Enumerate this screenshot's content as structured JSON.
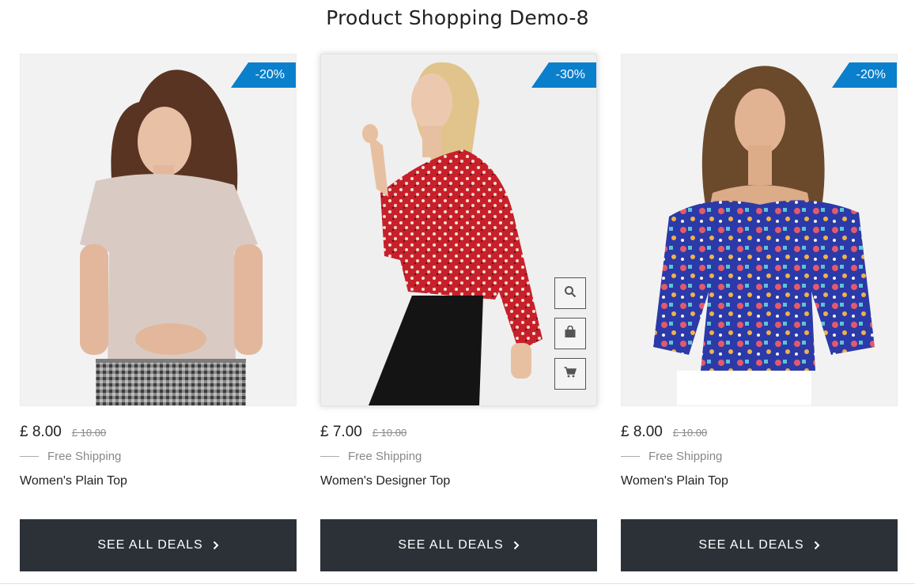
{
  "page": {
    "title": "Product Shopping Demo-8"
  },
  "products": [
    {
      "discount": "-20%",
      "price": "£ 8.00",
      "old_price": "£ 10.00",
      "shipping": "Free Shipping",
      "name": "Women's Plain Top",
      "cta": "SEE ALL DEALS"
    },
    {
      "discount": "-30%",
      "price": "£ 7.00",
      "old_price": "£ 10.00",
      "shipping": "Free Shipping",
      "name": "Women's Designer Top",
      "cta": "SEE ALL DEALS"
    },
    {
      "discount": "-20%",
      "price": "£ 8.00",
      "old_price": "£ 10.00",
      "shipping": "Free Shipping",
      "name": "Women's Plain Top",
      "cta": "SEE ALL DEALS"
    }
  ],
  "hover_actions": [
    "search-icon",
    "shopping-bag-icon",
    "cart-icon"
  ],
  "colors": {
    "badge": "#0a7fcc",
    "button": "#2c3138"
  }
}
